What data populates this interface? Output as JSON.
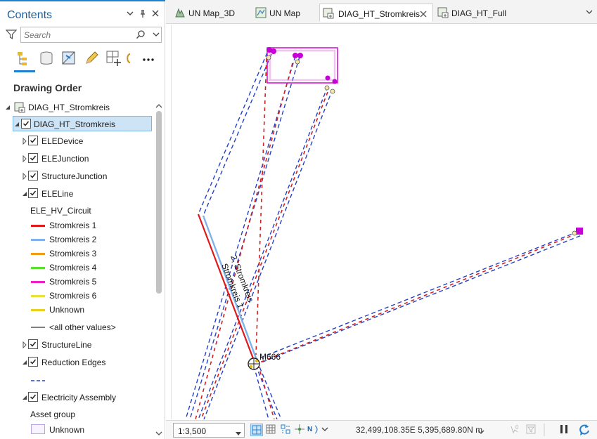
{
  "contents": {
    "title": "Contents",
    "search_placeholder": "Search",
    "section_heading": "Drawing Order"
  },
  "tree": {
    "map_name": "DIAG_HT_Stromkreis",
    "layer_group": "DIAG_HT_Stromkreis",
    "layers": [
      {
        "label": "ELEDevice",
        "checked": true
      },
      {
        "label": "ELEJunction",
        "checked": true
      },
      {
        "label": "StructureJunction",
        "checked": true
      },
      {
        "label": "ELELine",
        "checked": true
      }
    ],
    "eleline_field": "ELE_HV_Circuit",
    "legend": [
      {
        "label": "Stromkreis 1",
        "color": "#e0191b"
      },
      {
        "label": "Stromkreis 2",
        "color": "#7fb2ea"
      },
      {
        "label": "Stromkreis 3",
        "color": "#f39c12"
      },
      {
        "label": "Stromkreis 4",
        "color": "#58e22d"
      },
      {
        "label": "Stromkreis 5",
        "color": "#f01fc8"
      },
      {
        "label": "Stromkreis 6",
        "color": "#e8e23a"
      },
      {
        "label": "Unknown",
        "color": "#e8d21d"
      },
      {
        "label": "<all other values>",
        "color": "#808080"
      }
    ],
    "structure_line": "StructureLine",
    "reduction_edges": "Reduction Edges",
    "electricity_assembly": "Electricity Assembly",
    "asset_group": "Asset group",
    "asset_unknown": "Unknown"
  },
  "tabs": [
    {
      "label": "UN Map_3D",
      "icon": "globe-scene-icon"
    },
    {
      "label": "UN Map",
      "icon": "map-icon"
    },
    {
      "label": "DIAG_HT_Stromkreis",
      "icon": "diagram-icon",
      "active": true
    },
    {
      "label": "DIAG_HT_Full",
      "icon": "diagram-icon"
    }
  ],
  "map": {
    "label_circuit_2": "2, Stromkreis",
    "label_circuit_1": "Stromkreis 1",
    "junction_label": "M666"
  },
  "status": {
    "scale": "1:3,500",
    "coordinates": "32,499,108.35E 5,395,689.80N m"
  },
  "colors": {
    "accent": "#1e7fd3",
    "dashed_blue": "#2340c8",
    "dashed_red": "#d81e1e",
    "magenta": "#d418d4"
  }
}
